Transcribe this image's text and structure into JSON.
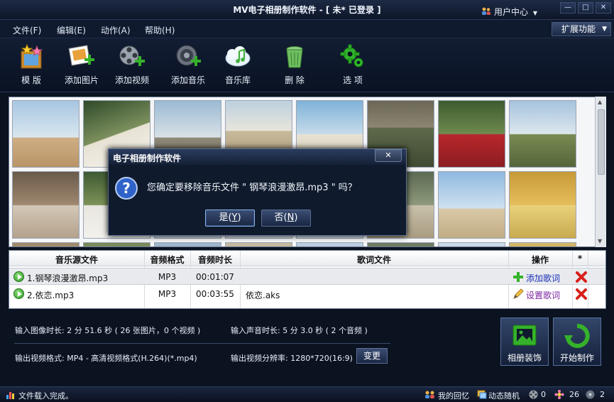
{
  "app": {
    "title": "MV电子相册制作软件 - [ 未* 已登录 ]",
    "user_center": "用户中心",
    "user_center_caret": "▼"
  },
  "window_controls": [
    "—",
    "□",
    "✕"
  ],
  "menu": [
    "文件(F)",
    "编辑(E)",
    "动作(A)",
    "帮助(H)"
  ],
  "ext_button": {
    "label": "扩展功能",
    "caret": "▼"
  },
  "toolbar": [
    {
      "label": "模 版",
      "icon": "template-icon"
    },
    {
      "label": "添加图片",
      "icon": "add-picture-icon"
    },
    {
      "label": "添加视频",
      "icon": "add-video-icon"
    },
    {
      "label": "添加音乐",
      "icon": "add-music-icon"
    },
    {
      "label": "音乐库",
      "icon": "music-library-icon"
    },
    {
      "label": "删 除",
      "icon": "trash-icon"
    },
    {
      "label": "选 项",
      "icon": "gear-icon"
    }
  ],
  "photos": {
    "count_visible": 24
  },
  "dialog": {
    "title": "电子相册制作软件",
    "close": "✕",
    "message": "您确定要移除音乐文件 \" 钢琴浪漫激昂.mp3 \" 吗？",
    "yes": "是(",
    "yes_key": "Y",
    "yes_end": ")",
    "no": "否(",
    "no_key": "N",
    "no_end": ")"
  },
  "music_table": {
    "headers": [
      "音乐源文件",
      "音频格式",
      "音频时长",
      "歌词文件",
      "操作",
      "*"
    ],
    "rows": [
      {
        "file": "1.钢琴浪漫激昂.mp3",
        "format": "MP3",
        "duration": "00:01:07",
        "lyrics": "",
        "action": "添加歌词"
      },
      {
        "file": "2.依恋.mp3",
        "format": "MP3",
        "duration": "00:03:55",
        "lyrics": "依恋.aks",
        "action": "设置歌词"
      }
    ]
  },
  "info": {
    "image_duration": "输入图像时长: 2 分 51.6 秒 ( 26 张图片，0 个视频 )",
    "audio_duration": "输入声音时长: 5 分 3.0 秒 ( 2 个音频 )",
    "output_format": "输出视频格式: MP4 - 高清视频格式(H.264)(*.mp4)",
    "output_resolution": "输出视频分辨率:  1280*720(16:9)",
    "change_button": "变更",
    "decorate_button": "相册装饰",
    "start_button": "开始制作"
  },
  "status": {
    "message": "文件载入完成。",
    "memories": "我的回忆",
    "dynamic_random": "动态随机",
    "count1": "0",
    "count2": "26",
    "count3": "2"
  },
  "colors": {
    "background": "#0b1220",
    "accent": "#2b4a7a",
    "link_blue": "#1a2fb8",
    "link_purple": "#7a1f9e",
    "delete_red": "#d8201a"
  }
}
